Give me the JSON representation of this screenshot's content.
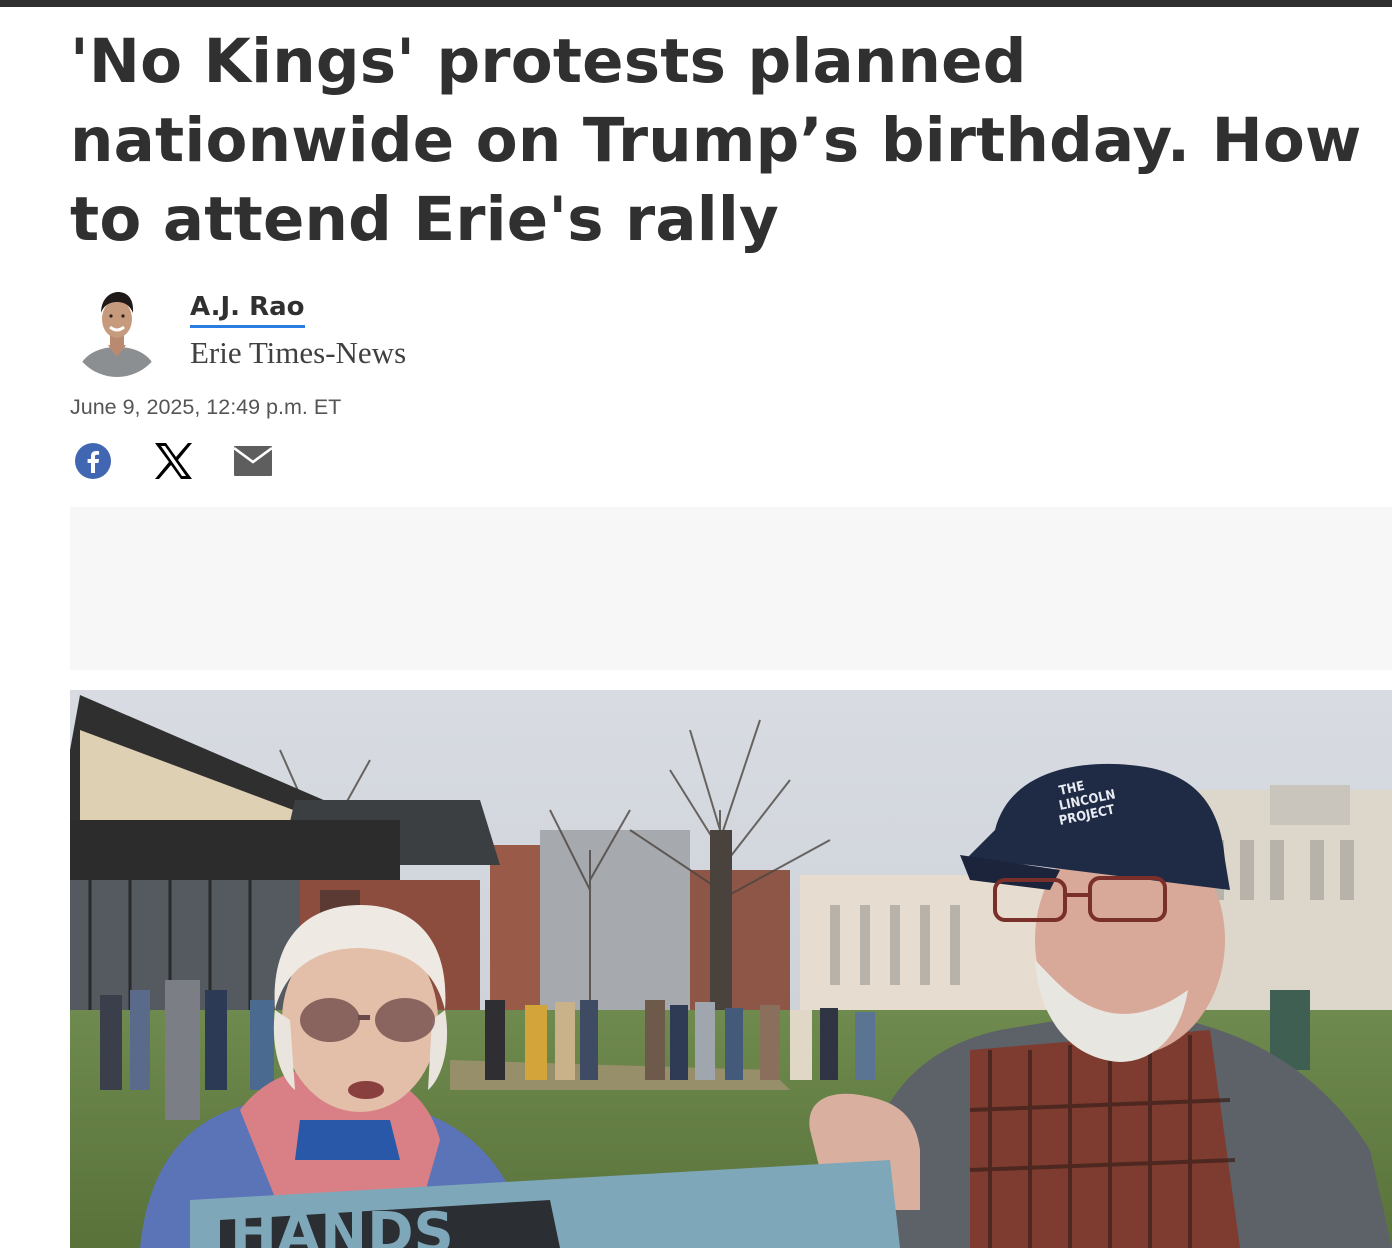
{
  "article": {
    "headline_line1": "'No Kings' protests planned",
    "headline_line2": "nationwide on Trump’s birthday. How",
    "headline_line3": "to attend Erie's rally",
    "author_name": "A.J. Rao",
    "publication": "Erie Times-News",
    "timestamp": "June 9, 2025, 12:49 p.m. ET"
  },
  "share": {
    "buttons": [
      {
        "icon": "facebook-icon",
        "color": "#3b5998"
      },
      {
        "icon": "x-icon",
        "color": "#000000"
      },
      {
        "icon": "email-icon",
        "color": "#5a5a5a"
      }
    ]
  },
  "photo": {
    "sign_text": "HANDS",
    "cap_text_line1": "THE",
    "cap_text_line2": "LINCOLN",
    "cap_text_line3": "PROJECT"
  },
  "colors": {
    "text": "#303030",
    "author_underline": "#2a7de1",
    "ad_slot_bg": "#f7f7f7"
  }
}
